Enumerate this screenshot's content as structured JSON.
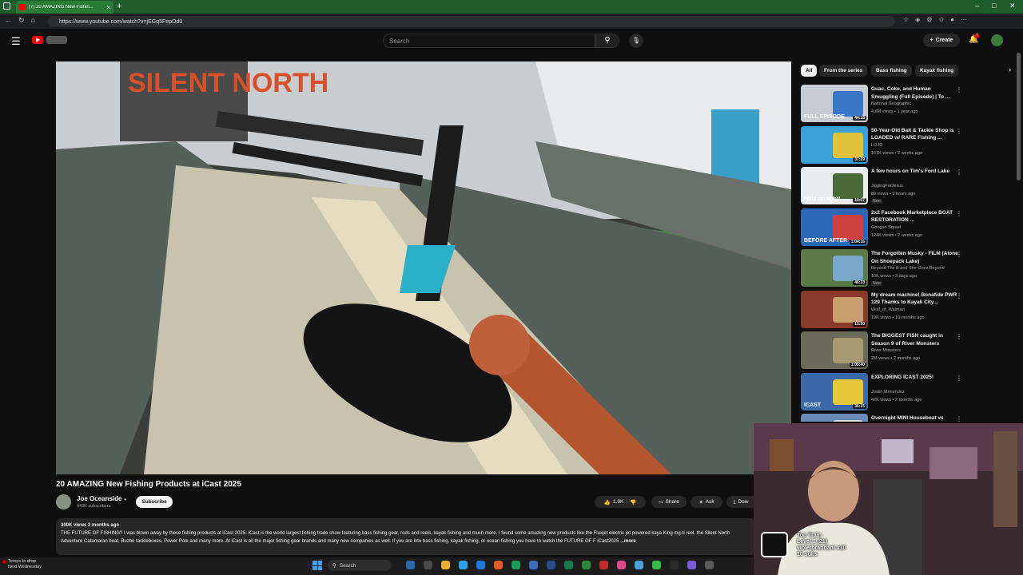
{
  "browser": {
    "tab_title": "(7) 20 AMAZING New Fishin...",
    "url": "https://www.youtube.com/watch?v=jEGq5FepOd0"
  },
  "header": {
    "search_placeholder": "Search",
    "create_label": "Create",
    "notifications_count": "7"
  },
  "video": {
    "title": "20 AMAZING New Fishing Products at iCast 2025",
    "channel": "Joe Oceanside",
    "subscribers": "443K subscribers",
    "subscribe_label": "Subscribe",
    "likes": "1.9K",
    "share_label": "Share",
    "ask_label": "Ask",
    "download_label": "Dow",
    "views_date": "300K views  2 months ago",
    "description": "THE FUTURE OF FISHING? I was blown away by these fishing products at iCast 2025. ICast is the world largest fishing trade show featuring bass fishing gear, rods and reels, kayak fishing and much more. I found some amazing new products like the Fluxjet electric jet powered kaya King mg-ti reel, the Silent North Adventure Catamaran boat, Buzbe tackleboxes, Power Pole  and many more. At iCast is all the major fishing gear brands and many new companies as well. If you are into bass fishing, kayak fishing, or ocean fishing you have to watch the FUTURE OF F iCast2025",
    "more_label": "...more",
    "overlay_brand": "SILENT NORTH"
  },
  "chips": [
    "All",
    "From the series",
    "Bass fishing",
    "Kayak fishing"
  ],
  "recommendations": [
    {
      "title": "Guac, Coke, and Human Smuggling (Full Episode) | To ...",
      "channel": "National Geographic",
      "meta": "4.6M views • 1 year ago",
      "duration": "44:18",
      "badge": "",
      "thumb_color": "#c8ccd2",
      "thumb_accent": "#3a76c8",
      "thumb_label": "FULL EPISODE"
    },
    {
      "title": "50-Year-Old Bait & Tackle Shop is LOADED w/ RARE Fishing ...",
      "channel": "LOJO",
      "meta": "167K views • 2 weeks ago",
      "duration": "37:29",
      "badge": "",
      "thumb_color": "#3aa0d8",
      "thumb_accent": "#e2c23a",
      "thumb_label": ""
    },
    {
      "title": "A few hours on Tim's Ford Lake",
      "channel": "JiggingForJesus",
      "meta": "89 views • 9 hours ago",
      "duration": "10:07",
      "badge": "New",
      "thumb_color": "#e8ecee",
      "thumb_accent": "#4a6a3a",
      "thumb_label": "Hold on tight!"
    },
    {
      "title": "2x2 Facebook Marketplace BOAT RESTORATION ...",
      "channel": "Googan Squad",
      "meta": "124K views • 2 weeks ago",
      "duration": "1:04:16",
      "badge": "",
      "thumb_color": "#2c68b8",
      "thumb_accent": "#d04040",
      "thumb_label": "BEFORE  AFTER"
    },
    {
      "title": "The Forgotten Musky - FILM (Alone On Shoepack Lake)",
      "channel": "Beyond The B and She Goes Beyond",
      "meta": "10K views • 3 days ago",
      "duration": "46:33",
      "badge": "New",
      "thumb_color": "#5a7a4a",
      "thumb_accent": "#7aa8c8",
      "thumb_label": ""
    },
    {
      "title": "My dream machine! Bonafide PWR 129 Thanks to Kayak City...",
      "channel": "Wolf_of_Walmart",
      "meta": "19K views • 10 months ago",
      "duration": "15:50",
      "badge": "",
      "thumb_color": "#8a3a2a",
      "thumb_accent": "#c8a070",
      "thumb_label": ""
    },
    {
      "title": "The BIGGEST FISH caught in Season 9 of River Monsters",
      "channel": "River Monsters",
      "meta": "2M views • 2 months ago",
      "duration": "1:05:40",
      "badge": "",
      "thumb_color": "#6a6a5a",
      "thumb_accent": "#a89a70",
      "thumb_label": ""
    },
    {
      "title": "EXPLORING ICAST 2025!",
      "channel": "Justin Menendez",
      "meta": "42K views • 2 months ago",
      "duration": "36:15",
      "badge": "",
      "thumb_color": "#3a6aa8",
      "thumb_accent": "#e8c838",
      "thumb_label": "ICAST"
    },
    {
      "title": "Overnight MINI Houseboat vs",
      "channel": "",
      "meta": "",
      "duration": "",
      "badge": "",
      "thumb_color": "#6a8ab8",
      "thumb_accent": "#d8d8d8",
      "thumb_label": ""
    }
  ],
  "webcam": {
    "line1": "Top Train",
    "line2": "Level 1  (21)",
    "line3": "violetbrandani x10",
    "line4": "10 subs"
  },
  "taskbar": {
    "weather_line1": "Temps to drop",
    "weather_line2": "Next Wednesday",
    "search_placeholder": "Search"
  }
}
